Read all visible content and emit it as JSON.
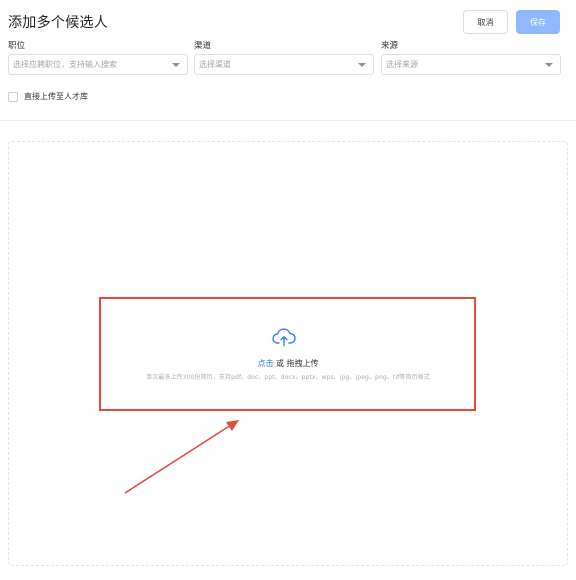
{
  "header": {
    "title": "添加多个候选人",
    "cancel_label": "取消",
    "save_label": "保存"
  },
  "fields": [
    {
      "label": "职位",
      "placeholder": "选择应聘职位，支持输入搜索"
    },
    {
      "label": "渠道",
      "placeholder": "选择渠道"
    },
    {
      "label": "来源",
      "placeholder": "选择来源"
    }
  ],
  "options": {
    "direct_upload_label": "直接上传至人才库",
    "direct_upload_checked": false
  },
  "upload": {
    "icon": "cloud-upload-icon",
    "click_text": "点击",
    "or_text": " 或 ",
    "drag_text": "拖拽上传",
    "hint": "单次最多上传300份简历，支持pdf、doc、ppt、docx、pptx、wps、jpg、jpeg、png、tif等简历格式"
  },
  "colors": {
    "accent": "#2f7ef5",
    "save_button": "#8fb8ff",
    "annotation": "#e04b3f"
  }
}
